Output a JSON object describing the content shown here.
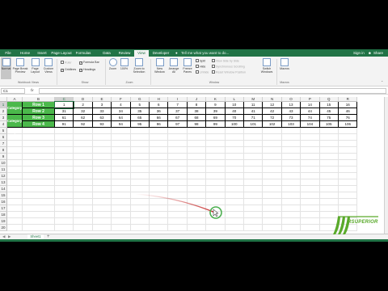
{
  "ribbon_tabs": [
    {
      "label": "File",
      "active": false
    },
    {
      "label": "Home",
      "active": false
    },
    {
      "label": "Insert",
      "active": false
    },
    {
      "label": "Page Layout",
      "active": false
    },
    {
      "label": "Formulas",
      "active": false
    },
    {
      "label": "Data",
      "active": false
    },
    {
      "label": "Review",
      "active": false
    },
    {
      "label": "View",
      "active": true
    },
    {
      "label": "Developer",
      "active": false
    }
  ],
  "tell_me": "Tell me what you want to do...",
  "sign_in": "Sign in",
  "share": "Share",
  "workbook_views": {
    "group_label": "Workbook Views",
    "normal": "Normal",
    "page_break_1": "Page Break",
    "page_break_2": "Preview",
    "page_layout_1": "Page",
    "page_layout_2": "Layout",
    "custom_views_1": "Custom",
    "custom_views_2": "Views"
  },
  "show": {
    "group_label": "Show",
    "ruler": "Ruler",
    "formula_bar": "Formula Bar",
    "gridlines": "Gridlines",
    "headings": "Headings"
  },
  "zoom": {
    "group_label": "Zoom",
    "zoom": "Zoom",
    "pct100": "100%",
    "zoom_sel_1": "Zoom to",
    "zoom_sel_2": "Selection"
  },
  "window": {
    "group_label": "Window",
    "new_window_1": "New",
    "new_window_2": "Window",
    "arrange_1": "Arrange",
    "arrange_2": "All",
    "freeze_1": "Freeze",
    "freeze_2": "Panes",
    "split": "Split",
    "hide": "Hide",
    "unhide": "Unhide",
    "side_by_side": "View Side by Side",
    "sync_scroll": "Synchronous Scrolling",
    "reset_pos": "Reset Window Position",
    "switch_1": "Switch",
    "switch_2": "Windows"
  },
  "macros": {
    "group_label": "Macros",
    "label": "Macros"
  },
  "formula_bar": {
    "name_box": "C1",
    "fx": "fx",
    "value": ""
  },
  "columns": [
    "A",
    "B",
    "C",
    "D",
    "E",
    "F",
    "G",
    "H",
    "I",
    "J",
    "K",
    "L",
    "M",
    "N",
    "O",
    "P",
    "Q",
    "R"
  ],
  "row_numbers": [
    "1",
    "2",
    "3",
    "4",
    "5",
    "6",
    "7",
    "8",
    "9",
    "10",
    "11",
    "12",
    "13",
    "14",
    "15",
    "16",
    "17",
    "18",
    "19",
    "20"
  ],
  "categories": [
    "Category 1",
    "Category 2"
  ],
  "row_labels": [
    "Row 1",
    "Row 2",
    "Row 3",
    "Row 4"
  ],
  "values": [
    [
      "1",
      "2",
      "3",
      "4",
      "5",
      "6",
      "7",
      "8",
      "9",
      "10",
      "11",
      "12",
      "13",
      "14",
      "15",
      "16"
    ],
    [
      "31",
      "32",
      "33",
      "34",
      "35",
      "36",
      "37",
      "38",
      "39",
      "40",
      "41",
      "42",
      "43",
      "44",
      "45",
      "46"
    ],
    [
      "61",
      "62",
      "63",
      "64",
      "65",
      "66",
      "67",
      "68",
      "69",
      "70",
      "71",
      "72",
      "73",
      "74",
      "75",
      "76"
    ],
    [
      "91",
      "92",
      "93",
      "94",
      "95",
      "96",
      "97",
      "98",
      "99",
      "100",
      "101",
      "102",
      "103",
      "104",
      "105",
      "106"
    ]
  ],
  "sheet_tab": "Sheet1",
  "add_sheet": "+",
  "logo_text": "RSUPERIOR",
  "colors": {
    "excel_green": "#217346",
    "category_fill": "#4bb84b",
    "pointer_trail": "#c62828",
    "cursor_ring": "#4caf50"
  }
}
